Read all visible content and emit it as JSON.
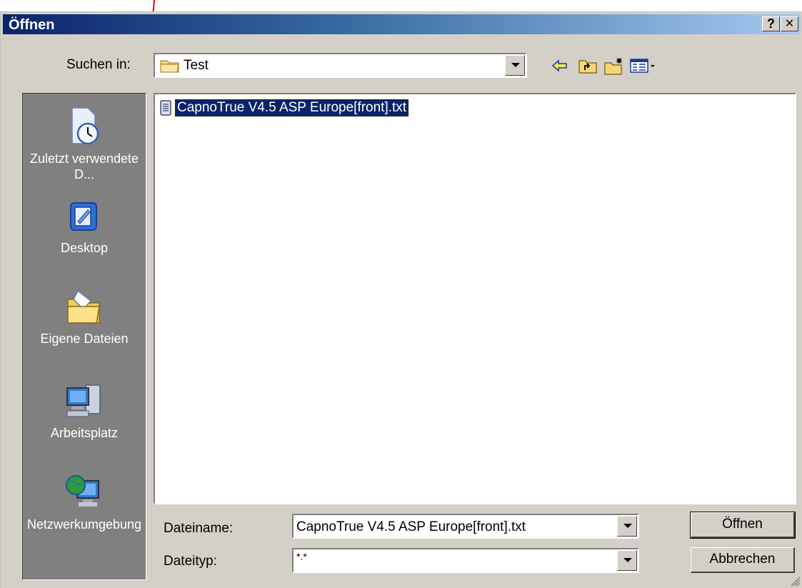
{
  "window": {
    "title": "Öffnen",
    "help_label": "?",
    "close_label": "✕"
  },
  "lookin": {
    "label": "Suchen in:",
    "value": "Test"
  },
  "toolbar": {
    "icons": [
      "back-arrow-icon",
      "up-folder-icon",
      "new-folder-icon",
      "view-menu-icon"
    ]
  },
  "places": [
    {
      "label": "Zuletzt verwendete D...",
      "icon": "recent-documents-icon"
    },
    {
      "label": "Desktop",
      "icon": "desktop-icon"
    },
    {
      "label": "Eigene Dateien",
      "icon": "my-documents-icon"
    },
    {
      "label": "Arbeitsplatz",
      "icon": "my-computer-icon"
    },
    {
      "label": "Netzwerkumgebung",
      "icon": "network-icon"
    }
  ],
  "files": [
    {
      "name": "CapnoTrue V4.5 ASP Europe[front].txt",
      "icon": "text-file-icon",
      "selected": true
    }
  ],
  "filename": {
    "label": "Dateiname:",
    "value": "CapnoTrue V4.5 ASP Europe[front].txt"
  },
  "filetype": {
    "label": "Dateityp:",
    "value": "*.*"
  },
  "buttons": {
    "open": "Öffnen",
    "cancel": "Abbrechen"
  },
  "colors": {
    "selection": "#0a246a",
    "dialog_bg": "#d4d0c8",
    "places_bg": "#808080",
    "annotation_arrow": "#e00000"
  }
}
